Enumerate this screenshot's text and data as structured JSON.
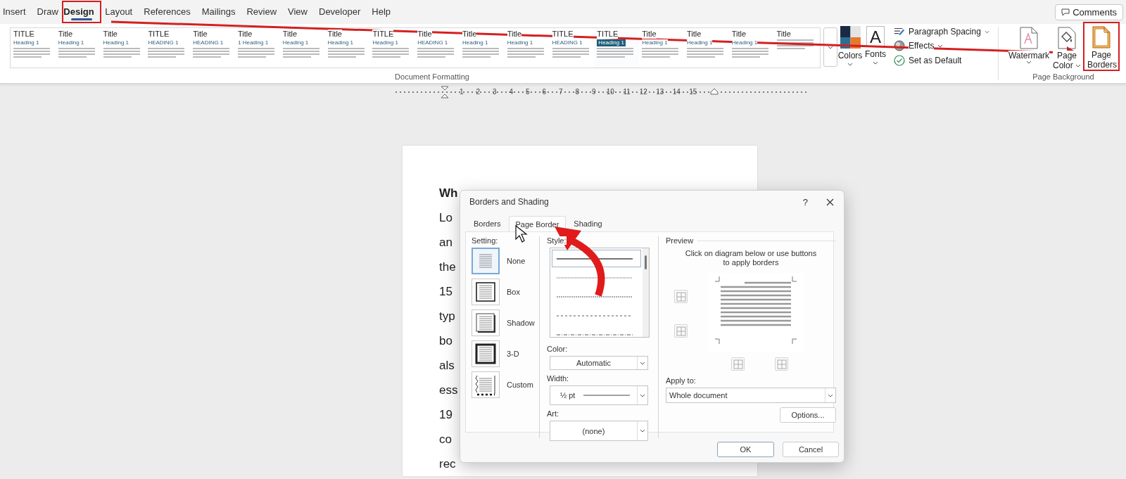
{
  "ribbon": {
    "tabs": [
      {
        "label": "Insert",
        "selected": false,
        "highlighted": false
      },
      {
        "label": "Draw",
        "selected": false,
        "highlighted": false
      },
      {
        "label": "Design",
        "selected": true,
        "highlighted": true
      },
      {
        "label": "Layout",
        "selected": false,
        "highlighted": false
      },
      {
        "label": "References",
        "selected": false,
        "highlighted": false
      },
      {
        "label": "Mailings",
        "selected": false,
        "highlighted": false
      },
      {
        "label": "Review",
        "selected": false,
        "highlighted": false
      },
      {
        "label": "View",
        "selected": false,
        "highlighted": false
      },
      {
        "label": "Developer",
        "selected": false,
        "highlighted": false
      },
      {
        "label": "Help",
        "selected": false,
        "highlighted": false
      }
    ],
    "comments_button": "Comments",
    "style_gallery": [
      {
        "title": "TITLE",
        "heading": "Heading 1",
        "kind": "plain"
      },
      {
        "title": "Title",
        "heading": "Heading 1",
        "kind": "plain"
      },
      {
        "title": "Title",
        "heading": "Heading 1",
        "kind": "plain"
      },
      {
        "title": "TITLE",
        "heading": "HEADING 1",
        "kind": "plain"
      },
      {
        "title": "Title",
        "heading": "HEADING 1",
        "kind": "plain"
      },
      {
        "title": "Title",
        "heading": "1 Heading 1",
        "kind": "plain"
      },
      {
        "title": "Title",
        "heading": "Heading 1",
        "kind": "plain"
      },
      {
        "title": "Title",
        "heading": "Heading 1",
        "kind": "plain"
      },
      {
        "title": "TITLE",
        "heading": "Heading 1",
        "kind": "plain"
      },
      {
        "title": "Title",
        "heading": "HEADING 1",
        "kind": "plain"
      },
      {
        "title": "Title",
        "heading": "Heading 1",
        "kind": "plain"
      },
      {
        "title": "Title",
        "heading": "Heading 1",
        "kind": "plain"
      },
      {
        "title": "TITLE",
        "heading": "HEADING 1",
        "kind": "plain"
      },
      {
        "title": "TITLE",
        "heading": "Heading 1",
        "kind": "shaded"
      },
      {
        "title": "Title",
        "heading": "Heading 1",
        "kind": "plain"
      },
      {
        "title": "Title",
        "heading": "Heading 1",
        "kind": "plain"
      },
      {
        "title": "Title",
        "heading": "Heading 1",
        "kind": "plain"
      },
      {
        "title": "Title",
        "kind": "plain"
      }
    ],
    "formatting_group_label": "Document Formatting",
    "theme_buttons": [
      {
        "label": "Colors",
        "kind": "colors",
        "dropdown": true
      },
      {
        "label": "Fonts",
        "kind": "fonts",
        "glyph": "A",
        "dropdown": true
      }
    ],
    "formatting_options": [
      {
        "label": "Paragraph Spacing",
        "kind": "spacing",
        "dropdown": true
      },
      {
        "label": "Effects",
        "kind": "effects",
        "dropdown": true
      },
      {
        "label": "Set as Default",
        "kind": "default",
        "dropdown": false
      }
    ],
    "background_buttons": [
      {
        "label": "Watermark",
        "kind": "watermark",
        "dropdown": true,
        "highlighted": false
      },
      {
        "label": "Page Color",
        "kind": "page-color",
        "dropdown": true,
        "highlighted": false
      },
      {
        "label": "Page Borders",
        "kind": "page-borders",
        "dropdown": false,
        "highlighted": true
      }
    ],
    "background_group_label": "Page Background"
  },
  "ruler": {
    "numbers": [
      "1",
      "2",
      "3",
      "4",
      "5",
      "6",
      "7",
      "8",
      "9",
      "10",
      "11",
      "12",
      "13",
      "14",
      "15"
    ]
  },
  "document": {
    "lines": [
      {
        "text": "Wh",
        "kind": "heading"
      },
      {
        "text": "Lo",
        "kind": "body"
      },
      {
        "text": "an",
        "kind": "body"
      },
      {
        "text": "the",
        "kind": "body"
      },
      {
        "text": "15",
        "kind": "body"
      },
      {
        "text": "typ",
        "kind": "body"
      },
      {
        "text": "bo",
        "kind": "body"
      },
      {
        "text": "als",
        "kind": "body"
      },
      {
        "text": "ess",
        "kind": "body"
      },
      {
        "text": "19",
        "kind": "body"
      },
      {
        "text": "co",
        "kind": "body"
      },
      {
        "text": "rec",
        "kind": "body"
      }
    ]
  },
  "dialog": {
    "title": "Borders and Shading",
    "help_button": "?",
    "tabs": [
      {
        "label": "Borders",
        "selected": false
      },
      {
        "label": "Page Border",
        "selected": true
      },
      {
        "label": "Shading",
        "selected": false
      }
    ],
    "setting_label": "Setting:",
    "settings": [
      {
        "label": "None",
        "kind": "none",
        "selected": true
      },
      {
        "label": "Box",
        "kind": "box",
        "selected": false
      },
      {
        "label": "Shadow",
        "kind": "shadow",
        "selected": false
      },
      {
        "label": "3-D",
        "kind": "threed",
        "selected": false
      },
      {
        "label": "Custom",
        "kind": "custom",
        "selected": false
      }
    ],
    "style_label": "Style:",
    "styles": [
      {
        "kind": "solid",
        "selected": true
      },
      {
        "kind": "dotted",
        "selected": false
      },
      {
        "kind": "finedash",
        "selected": false
      },
      {
        "kind": "dashed",
        "selected": false
      },
      {
        "kind": "dashdot",
        "selected": false
      }
    ],
    "color_label": "Color:",
    "color_value": "Automatic",
    "width_label": "Width:",
    "width_value": "½ pt",
    "art_label": "Art:",
    "art_value": "(none)",
    "preview_label": "Preview",
    "preview_hint": "Click on diagram below or use buttons\nto apply borders",
    "apply_label": "Apply to:",
    "apply_value": "Whole document",
    "options_button": "Options...",
    "ok_button": "OK",
    "cancel_button": "Cancel"
  }
}
